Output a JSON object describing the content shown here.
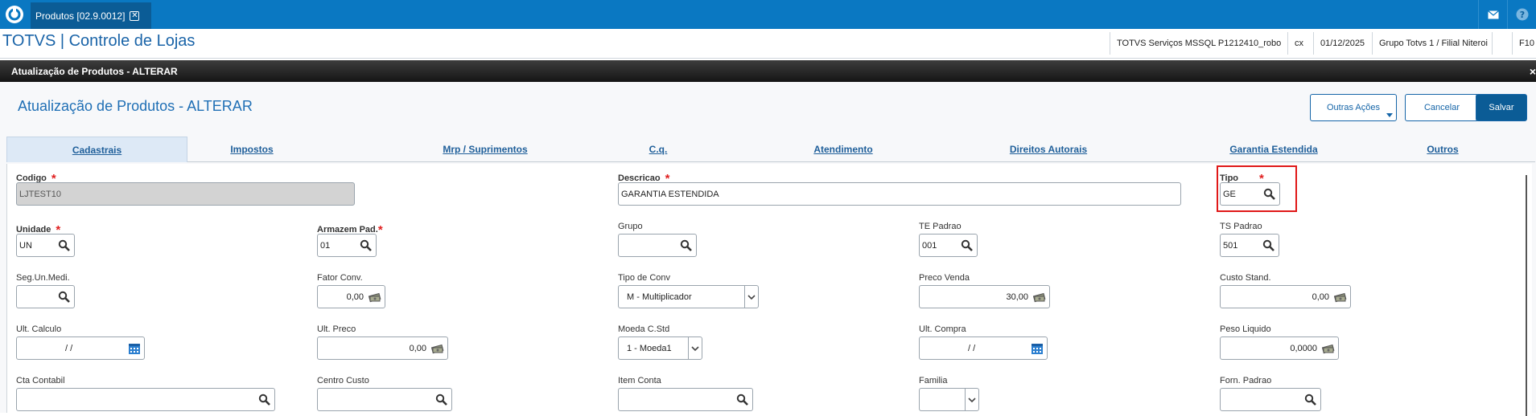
{
  "topbar": {
    "tab_label": "Produtos [02.9.0012]",
    "tab_close": "✕"
  },
  "appbar": {
    "title": "TOTVS | Controle de Lojas",
    "env": "TOTVS Serviços MSSQL P1212410_robo",
    "user": "cx",
    "date": "01/12/2025",
    "branch": "Grupo Totvs 1 / Filial Niteroi",
    "shortcut": "F10"
  },
  "window": {
    "title": "Atualização de Produtos - ALTERAR",
    "close": "×"
  },
  "form": {
    "title": "Atualização de Produtos - ALTERAR",
    "actions": {
      "more": "Outras Ações",
      "cancel": "Cancelar",
      "save": "Salvar"
    },
    "tabs": [
      "Cadastrais",
      "Impostos",
      "Mrp / Suprimentos",
      "C.q.",
      "Atendimento",
      "Direitos Autorais",
      "Garantia Estendida",
      "Outros"
    ],
    "fields": {
      "codigo": {
        "label": "Codigo",
        "value": "LJTEST10"
      },
      "descricao": {
        "label": "Descricao",
        "value": "GARANTIA ESTENDIDA"
      },
      "tipo": {
        "label": "Tipo",
        "value": "GE"
      },
      "unidade": {
        "label": "Unidade",
        "value": "UN"
      },
      "armazem": {
        "label": "Armazem Pad.",
        "value": "01"
      },
      "grupo": {
        "label": "Grupo",
        "value": ""
      },
      "te_padrao": {
        "label": "TE Padrao",
        "value": "001"
      },
      "ts_padrao": {
        "label": "TS Padrao",
        "value": "501"
      },
      "seg_un": {
        "label": "Seg.Un.Medi.",
        "value": ""
      },
      "fator_conv": {
        "label": "Fator Conv.",
        "value": "0,00"
      },
      "tipo_conv": {
        "label": "Tipo de Conv",
        "value": "M - Multiplicador"
      },
      "preco_venda": {
        "label": "Preco Venda",
        "value": "30,00"
      },
      "custo_stand": {
        "label": "Custo Stand.",
        "value": "0,00"
      },
      "ult_calculo": {
        "label": "Ult. Calculo",
        "value": "/ /"
      },
      "ult_preco": {
        "label": "Ult. Preco",
        "value": "0,00"
      },
      "moeda": {
        "label": "Moeda C.Std",
        "value": "1 - Moeda1"
      },
      "ult_compra": {
        "label": "Ult. Compra",
        "value": "/ /"
      },
      "peso": {
        "label": "Peso Liquido",
        "value": "0,0000"
      },
      "cta_contabil": {
        "label": "Cta Contabil",
        "value": ""
      },
      "centro_custo": {
        "label": "Centro Custo",
        "value": ""
      },
      "item_conta": {
        "label": "Item Conta",
        "value": ""
      },
      "familia": {
        "label": "Familia",
        "value": ""
      },
      "forn_padrao": {
        "label": "Forn. Padrao",
        "value": ""
      }
    },
    "required_marker": "*"
  },
  "colors": {
    "brand": "#0a78c2",
    "highlight": "#e01818",
    "required": "#e02020"
  }
}
